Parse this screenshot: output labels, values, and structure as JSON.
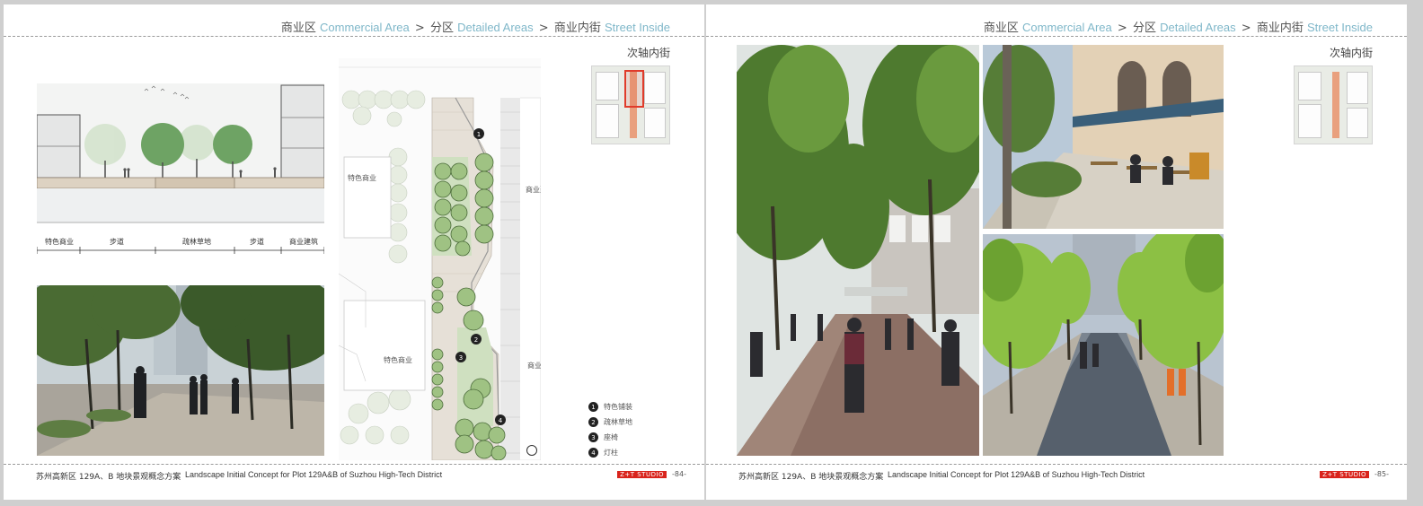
{
  "breadcrumb": {
    "level1_cn": "商业区",
    "level1_en": "Commercial Area",
    "level2_cn": "分区",
    "level2_en": "Detailed Areas",
    "level3_cn": "商业内街",
    "level3_en": "Street Inside",
    "separator": ">"
  },
  "subheading": "次轴内街",
  "section_labels": [
    "特色商业",
    "步道",
    "疏林草地",
    "步道",
    "商业建筑"
  ],
  "plan_labels": {
    "commercial_feature_top": "特色商业",
    "commercial_building_top": "商业建筑",
    "commercial_feature_bottom": "特色商业",
    "commercial_building_bottom": "商业建筑"
  },
  "plan_markers": [
    "1",
    "2",
    "3",
    "4"
  ],
  "legend": [
    {
      "num": "1",
      "label": "特色铺装"
    },
    {
      "num": "2",
      "label": "疏林草地"
    },
    {
      "num": "3",
      "label": "座椅"
    },
    {
      "num": "4",
      "label": "灯柱"
    }
  ],
  "footer": {
    "project_cn": "苏州高新区 129A、B 地块景观概念方案",
    "project_en": "Landscape Initial Concept for Plot 129A&B of Suzhou High-Tech District",
    "studio": "Z+T STUDIO",
    "left_page": "-84-",
    "right_page": "-85-"
  },
  "colors": {
    "accent_en": "#7fb7c9",
    "studio_red": "#d9241c",
    "highlight": "#e03b2b"
  }
}
